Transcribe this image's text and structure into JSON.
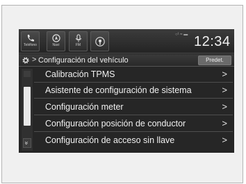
{
  "topbar": {
    "tabs": [
      {
        "label": "Teléfono",
        "icon": "phone-icon"
      },
      {
        "label": "Navi",
        "icon": "navi-icon"
      },
      {
        "label": "FM",
        "icon": "radio-icon"
      },
      {
        "label": "",
        "icon": "audio-source-icon"
      }
    ],
    "status": "○¹ ≈ ▬",
    "clock": "12:34"
  },
  "header": {
    "title": "Configuración del vehículo",
    "breadcrumb_arrow": ">",
    "default_button": "Predet."
  },
  "menu": {
    "items": [
      {
        "label": "Calibración TPMS",
        "chevron": ">"
      },
      {
        "label": "Asistente de configuración de sistema",
        "chevron": ">"
      },
      {
        "label": "Configuración meter",
        "chevron": ">"
      },
      {
        "label": "Configuración posición de conductor",
        "chevron": ">"
      },
      {
        "label": "Configuración de acceso sin llave",
        "chevron": ">"
      }
    ]
  },
  "scrollbar": {
    "down_glyph": "»"
  }
}
